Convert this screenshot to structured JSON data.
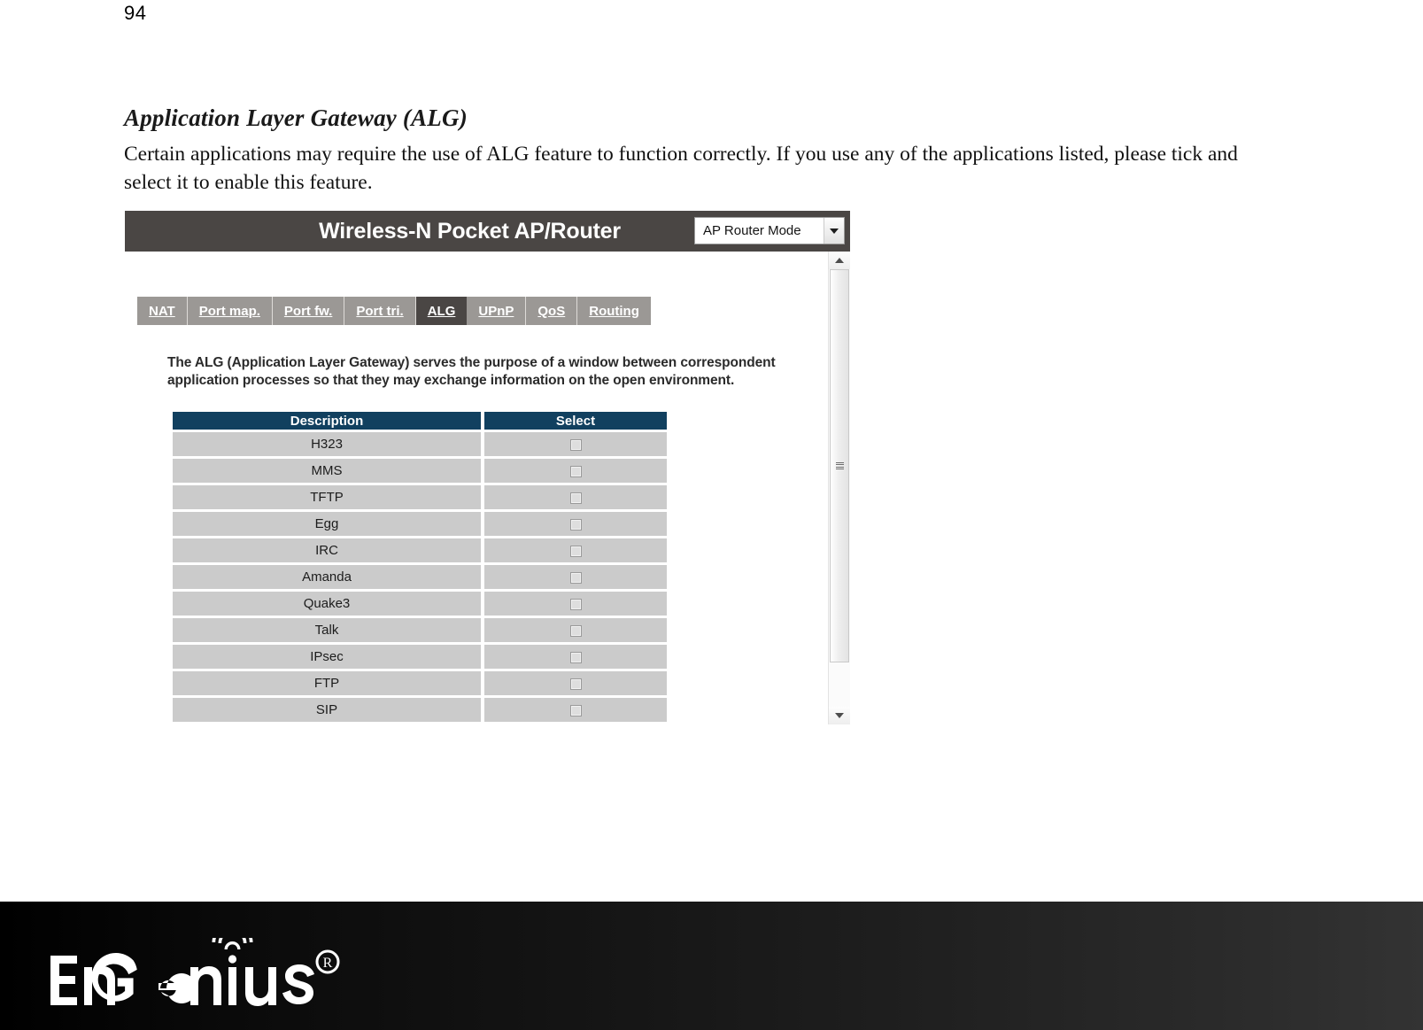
{
  "page": {
    "number": "94"
  },
  "document": {
    "heading": "Application Layer Gateway (ALG)",
    "paragraph": "Certain applications may require the use of ALG feature to function correctly. If you use any of the applications listed, please tick and select it to enable this feature."
  },
  "router_ui": {
    "title": "Wireless-N Pocket AP/Router",
    "mode_select": {
      "selected": "AP Router Mode",
      "icon": "chevron-down-icon"
    },
    "tabs": [
      {
        "label": "NAT",
        "active": false
      },
      {
        "label": "Port map.",
        "active": false
      },
      {
        "label": "Port fw.",
        "active": false
      },
      {
        "label": "Port tri.",
        "active": false
      },
      {
        "label": "ALG",
        "active": true
      },
      {
        "label": "UPnP",
        "active": false
      },
      {
        "label": "QoS",
        "active": false
      },
      {
        "label": "Routing",
        "active": false
      }
    ],
    "description": "The ALG (Application Layer Gateway) serves the purpose of a window between correspondent application processes so that they may exchange information on the open environment.",
    "table": {
      "headers": [
        "Description",
        "Select"
      ],
      "rows": [
        {
          "description": "H323",
          "checked": false
        },
        {
          "description": "MMS",
          "checked": false
        },
        {
          "description": "TFTP",
          "checked": false
        },
        {
          "description": "Egg",
          "checked": false
        },
        {
          "description": "IRC",
          "checked": false
        },
        {
          "description": "Amanda",
          "checked": false
        },
        {
          "description": "Quake3",
          "checked": false
        },
        {
          "description": "Talk",
          "checked": false
        },
        {
          "description": "IPsec",
          "checked": false
        },
        {
          "description": "FTP",
          "checked": false
        },
        {
          "description": "SIP",
          "checked": false
        }
      ]
    },
    "scrollbar": {
      "up_icon": "scroll-up-arrow-icon",
      "down_icon": "scroll-down-arrow-icon",
      "grip_icon": "scrollbar-grip-icon"
    },
    "colors": {
      "header_bar": "#4a4644",
      "tab_strip": "#9b9895",
      "tab_active": "#4a4644",
      "table_header": "#11405f",
      "table_row": "#cbcbcb"
    }
  },
  "footer": {
    "brand": "EnGenius",
    "registered_mark": "®"
  }
}
